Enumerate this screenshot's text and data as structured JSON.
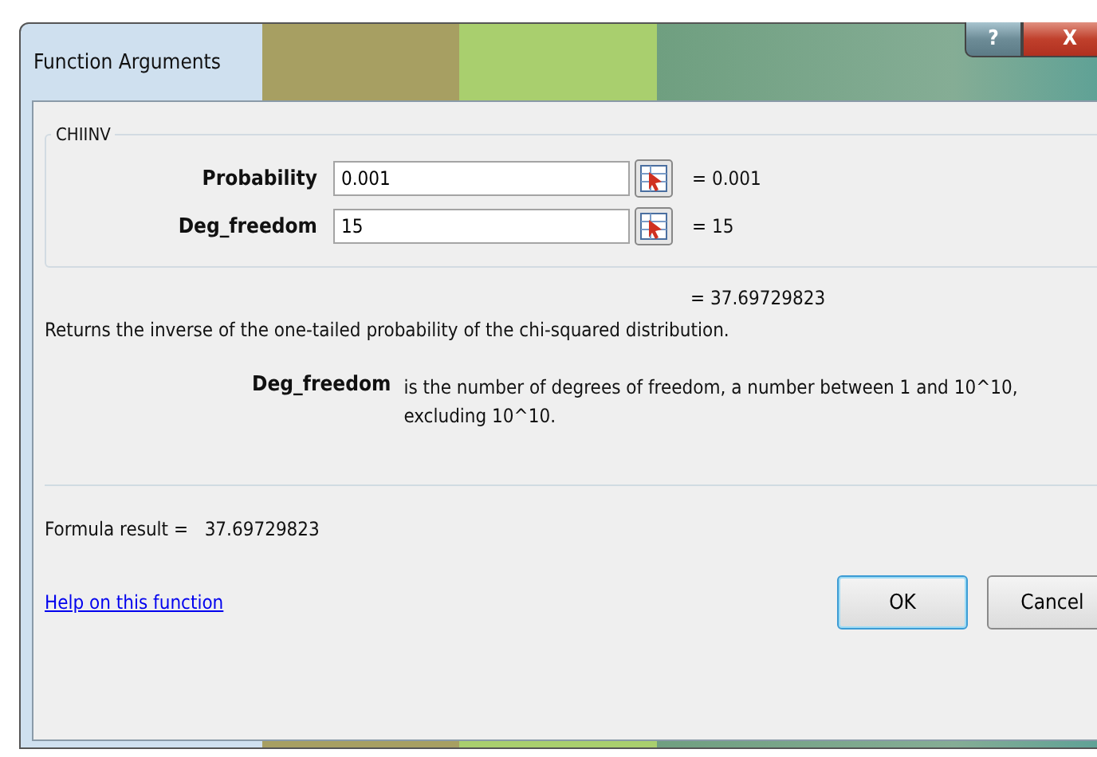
{
  "window": {
    "title": "Function Arguments",
    "buttons": [
      "?",
      "X"
    ]
  },
  "function_group": {
    "name": "CHIINV",
    "arguments": [
      {
        "label": "Probability",
        "value": "0.001",
        "result": "= 0.001"
      },
      {
        "label": "Deg_freedom",
        "value": "15",
        "result": "= 15"
      }
    ]
  },
  "overall_result": "= 37.69729823",
  "description": "Returns the inverse of the one-tailed probability of the chi-squared distribution.",
  "argument_help": {
    "name": "Deg_freedom",
    "text": "is the number of degrees of freedom, a number between 1 and 10^10, excluding 10^10."
  },
  "formula_result": {
    "label": "Formula result =",
    "value": "37.69729823"
  },
  "help_link": "Help on this function",
  "buttons": [
    {
      "label": "OK",
      "default": true
    },
    {
      "label": "Cancel",
      "default": false
    }
  ]
}
